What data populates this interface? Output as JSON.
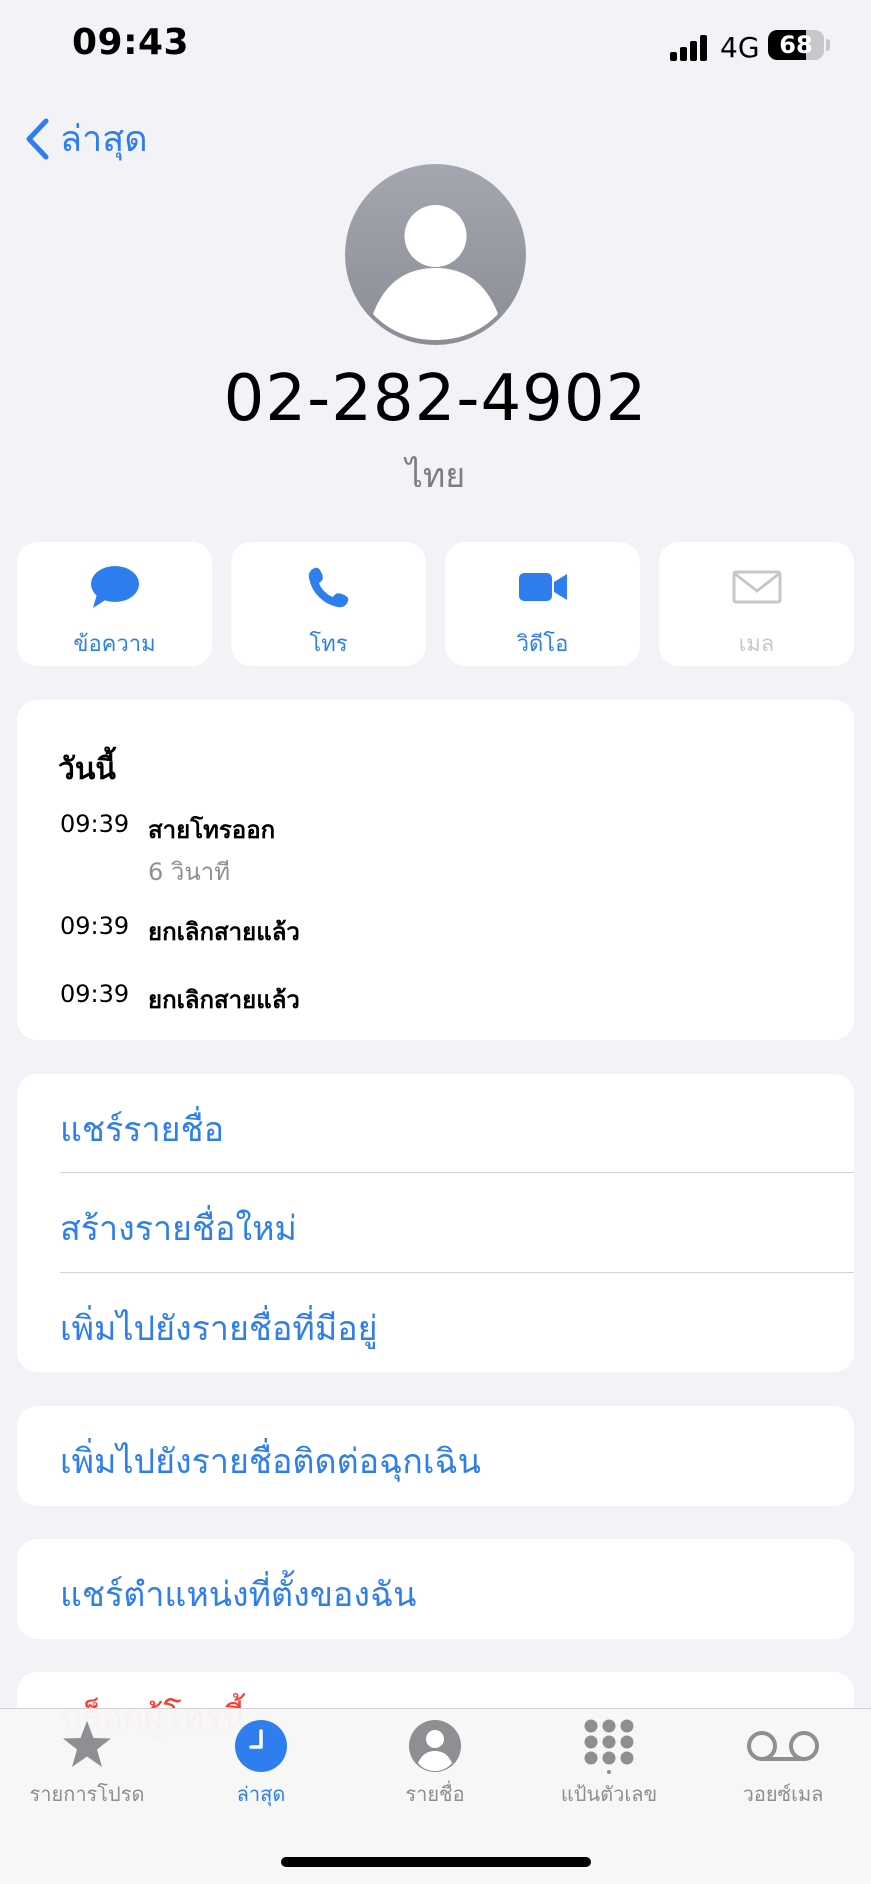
{
  "status": {
    "time": "09:43",
    "network": "4G",
    "battery": "68",
    "battery_level": 0.68
  },
  "nav": {
    "back_label": "ล่าสุด"
  },
  "contact": {
    "number": "02-282-4902",
    "label": "ไทย"
  },
  "actions": [
    {
      "label": "ข้อความ",
      "icon": "message-bubble-icon",
      "enabled": true
    },
    {
      "label": "โทร",
      "icon": "phone-icon",
      "enabled": true
    },
    {
      "label": "วิดีโอ",
      "icon": "video-camera-icon",
      "enabled": true
    },
    {
      "label": "เมล",
      "icon": "mail-envelope-icon",
      "enabled": false
    }
  ],
  "history": {
    "title": "วันนี้",
    "entries": [
      {
        "time": "09:39",
        "type": "สายโทรออก",
        "duration": "6 วินาที"
      },
      {
        "time": "09:39",
        "type": "ยกเลิกสายแล้ว",
        "duration": ""
      },
      {
        "time": "09:39",
        "type": "ยกเลิกสายแล้ว",
        "duration": ""
      }
    ]
  },
  "options": {
    "share_contact": "แชร์รายชื่อ",
    "create_new_contact": "สร้างรายชื่อใหม่",
    "add_to_existing": "เพิ่มไปยังรายชื่อที่มีอยู่",
    "add_to_emergency": "เพิ่มไปยังรายชื่อติดต่อฉุกเฉิน",
    "share_location": "แชร์ตำแหน่งที่ตั้งของฉัน",
    "block_caller": "บล็อกผู้โทรนี้"
  },
  "tabs": [
    {
      "label": "รายการโปรด",
      "icon": "star-icon",
      "active": false
    },
    {
      "label": "ล่าสุด",
      "icon": "clock-icon",
      "active": true
    },
    {
      "label": "รายชื่อ",
      "icon": "person-circle-icon",
      "active": false
    },
    {
      "label": "แป้นตัวเลข",
      "icon": "keypad-icon",
      "active": false
    },
    {
      "label": "วอยซ์เมล",
      "icon": "voicemail-icon",
      "active": false
    }
  ],
  "colors": {
    "accent": "#2f7ef0",
    "background": "#f2f2f7",
    "danger": "#ff3b30",
    "inactive": "#8e8e93"
  }
}
